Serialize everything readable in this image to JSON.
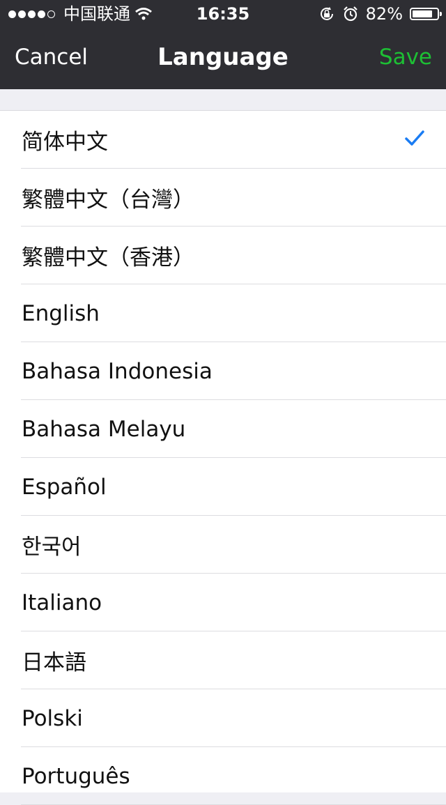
{
  "status": {
    "carrier": "中国联通",
    "time": "16:35",
    "battery": "82%",
    "battery_level": 0.82
  },
  "nav": {
    "cancel_label": "Cancel",
    "title": "Language",
    "save_label": "Save"
  },
  "selected_index": 0,
  "languages": [
    "简体中文",
    "繁體中文（台灣）",
    "繁體中文（香港）",
    "English",
    "Bahasa Indonesia",
    "Bahasa Melayu",
    "Español",
    "한국어",
    "Italiano",
    "日本語",
    "Polski",
    "Português"
  ],
  "colors": {
    "accent_save": "#1dbf34",
    "check": "#1a7cf3",
    "header_bg": "#2e2e33"
  },
  "icons": [
    "signal-dots-icon",
    "wifi-icon",
    "orientation-lock-icon",
    "alarm-icon",
    "battery-icon",
    "checkmark-icon"
  ]
}
